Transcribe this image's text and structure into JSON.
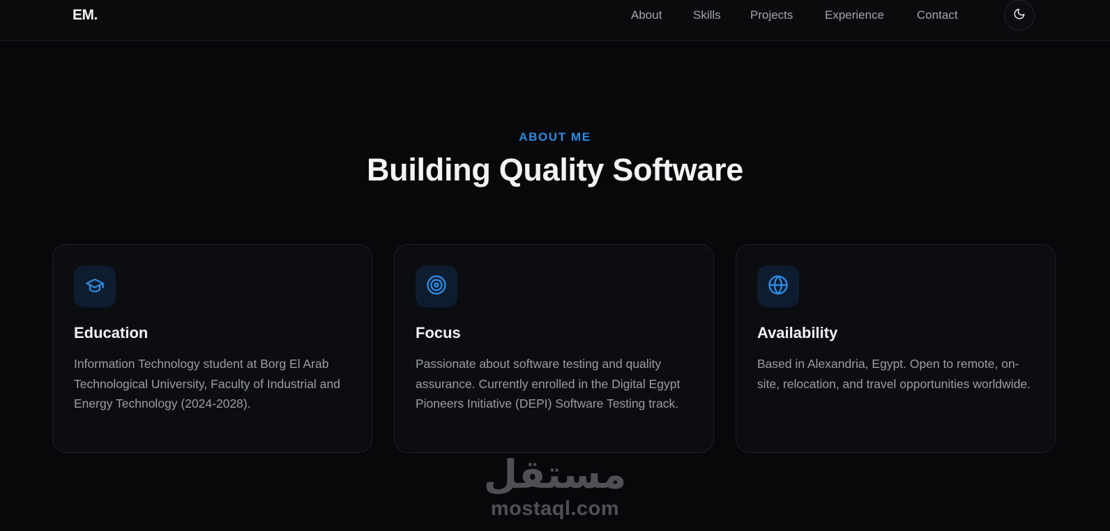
{
  "nav": {
    "logo": "EM.",
    "links": [
      {
        "label": "About"
      },
      {
        "label": "Skills"
      },
      {
        "label": "Projects"
      },
      {
        "label": "Experience"
      },
      {
        "label": "Contact"
      }
    ],
    "theme_toggle_icon": "moon-icon"
  },
  "about": {
    "eyebrow": "ABOUT ME",
    "title": "Building Quality Software",
    "cards": [
      {
        "icon": "graduation-cap-icon",
        "title": "Education",
        "text": "Information Technology student at Borg El Arab Technological University, Faculty of Industrial and Energy Technology (2024-2028)."
      },
      {
        "icon": "target-icon",
        "title": "Focus",
        "text": "Passionate about software testing and quality assurance. Currently enrolled in the Digital Egypt Pioneers Initiative (DEPI) Software Testing track."
      },
      {
        "icon": "globe-icon",
        "title": "Availability",
        "text": "Based in Alexandria, Egypt. Open to remote, on-site, relocation, and travel opportunities worldwide."
      }
    ]
  },
  "watermark": {
    "arabic": "مستقل",
    "latin": "mostaql.com"
  },
  "colors": {
    "accent": "#2d8ce3",
    "background": "#07080a",
    "card_background": "#0c0d10",
    "icon_tile": "#0d1c2e"
  }
}
